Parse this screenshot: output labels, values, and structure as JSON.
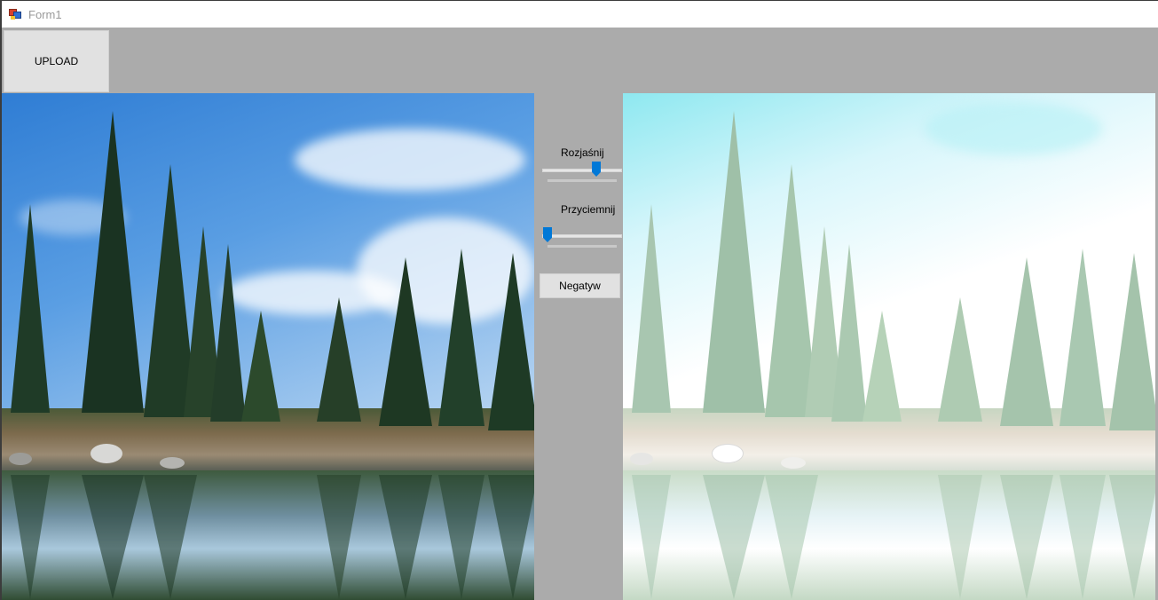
{
  "window": {
    "title": "Form1"
  },
  "toolbar": {
    "upload_label": "UPLOAD"
  },
  "controls": {
    "brighten": {
      "label": "Rozjaśnij",
      "value_fraction": 0.67
    },
    "darken": {
      "label": "Przyciemnij",
      "value_fraction": 0.0
    },
    "negative_label": "Negatyw"
  },
  "images": {
    "original": "forest-lake-photo",
    "processed": "forest-lake-photo-brightened"
  },
  "colors": {
    "form_bg": "#ababab",
    "button_bg": "#e1e1e1",
    "slider_thumb": "#0078d7"
  }
}
